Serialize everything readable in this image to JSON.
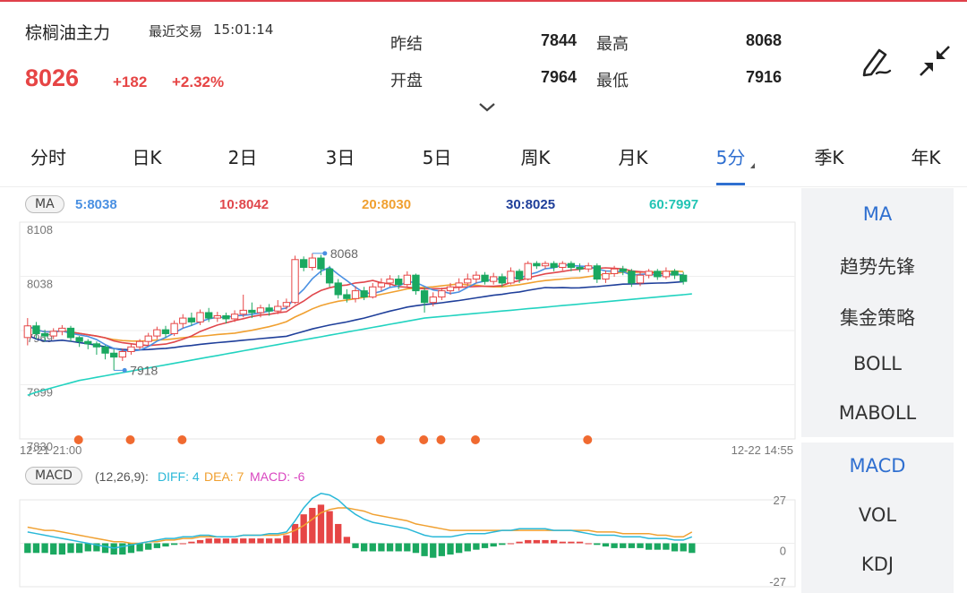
{
  "header": {
    "symbol": "棕榈油主力",
    "last_trade_label": "最近交易",
    "last_trade_time": "15:01:14",
    "price": "8026",
    "change": "+182",
    "change_pct": "+2.32%",
    "quote": {
      "prev_settle_label": "昨结",
      "prev_settle": "7844",
      "high_label": "最高",
      "high": "8068",
      "open_label": "开盘",
      "open": "7964",
      "low_label": "最低",
      "low": "7916"
    }
  },
  "tabs": [
    {
      "label": "分时"
    },
    {
      "label": "日K"
    },
    {
      "label": "2日"
    },
    {
      "label": "3日"
    },
    {
      "label": "5日"
    },
    {
      "label": "周K"
    },
    {
      "label": "月K"
    },
    {
      "label": "5分"
    },
    {
      "label": "季K"
    },
    {
      "label": "年K"
    }
  ],
  "active_tab": "5分",
  "ma_bar": {
    "badge": "MA",
    "ma5": "5:8038",
    "ma10": "10:8042",
    "ma20": "20:8030",
    "ma30": "30:8025",
    "ma60": "60:7997"
  },
  "price_axis": [
    "8108",
    "8038",
    "7969",
    "7899",
    "7830"
  ],
  "annotations": {
    "high": "8068",
    "low": "7918"
  },
  "time_axis": {
    "start": "12-21 21:00",
    "end": "12-22 14:55"
  },
  "macd_bar": {
    "badge": "MACD",
    "params": "(12,26,9):",
    "diff": "DIFF: 4",
    "dea": "DEA: 7",
    "macd": "MACD: -6"
  },
  "macd_axis": [
    "27",
    "0",
    "-27"
  ],
  "side_menu": {
    "group1": [
      "MA",
      "趋势先锋",
      "集金策略",
      "BOLL",
      "MABOLL"
    ],
    "group2": [
      "MACD",
      "VOL",
      "KDJ"
    ]
  },
  "colors": {
    "up": "#e64545",
    "down": "#1aa860",
    "accent": "#2f6fd0",
    "ma5": "#4a90e2",
    "ma10": "#e0474c",
    "ma20": "#f0a030",
    "ma30": "#1f3f9a",
    "ma60": "#22d3c0",
    "diff": "#2ab8d8",
    "dea": "#f0a030",
    "macd": "#d946c0"
  },
  "chart_data": [
    {
      "type": "candlestick",
      "interval": "5分",
      "ylim": [
        7830,
        8108
      ],
      "candles": [
        {
          "o": 7960,
          "c": 7975,
          "h": 7985,
          "l": 7950
        },
        {
          "o": 7975,
          "c": 7965,
          "h": 7980,
          "l": 7958
        },
        {
          "o": 7965,
          "c": 7962,
          "h": 7970,
          "l": 7955
        },
        {
          "o": 7962,
          "c": 7968,
          "h": 7972,
          "l": 7958
        },
        {
          "o": 7968,
          "c": 7972,
          "h": 7976,
          "l": 7963
        },
        {
          "o": 7972,
          "c": 7960,
          "h": 7975,
          "l": 7955
        },
        {
          "o": 7960,
          "c": 7955,
          "h": 7962,
          "l": 7948
        },
        {
          "o": 7955,
          "c": 7952,
          "h": 7958,
          "l": 7945
        },
        {
          "o": 7952,
          "c": 7948,
          "h": 7955,
          "l": 7938
        },
        {
          "o": 7948,
          "c": 7940,
          "h": 7950,
          "l": 7932
        },
        {
          "o": 7940,
          "c": 7935,
          "h": 7945,
          "l": 7918
        },
        {
          "o": 7935,
          "c": 7942,
          "h": 7946,
          "l": 7930
        },
        {
          "o": 7942,
          "c": 7948,
          "h": 7952,
          "l": 7938
        },
        {
          "o": 7948,
          "c": 7955,
          "h": 7958,
          "l": 7944
        },
        {
          "o": 7955,
          "c": 7962,
          "h": 7966,
          "l": 7950
        },
        {
          "o": 7962,
          "c": 7970,
          "h": 7974,
          "l": 7958
        },
        {
          "o": 7970,
          "c": 7965,
          "h": 7975,
          "l": 7960
        },
        {
          "o": 7965,
          "c": 7978,
          "h": 7982,
          "l": 7962
        },
        {
          "o": 7978,
          "c": 7985,
          "h": 7990,
          "l": 7972
        },
        {
          "o": 7985,
          "c": 7980,
          "h": 7992,
          "l": 7975
        },
        {
          "o": 7980,
          "c": 7992,
          "h": 7996,
          "l": 7976
        },
        {
          "o": 7992,
          "c": 7985,
          "h": 7998,
          "l": 7980
        },
        {
          "o": 7985,
          "c": 7988,
          "h": 7993,
          "l": 7980
        },
        {
          "o": 7988,
          "c": 7984,
          "h": 7992,
          "l": 7978
        },
        {
          "o": 7984,
          "c": 7990,
          "h": 7995,
          "l": 7980
        },
        {
          "o": 7990,
          "c": 7995,
          "h": 8015,
          "l": 7986
        },
        {
          "o": 7995,
          "c": 7992,
          "h": 8005,
          "l": 7985
        },
        {
          "o": 7992,
          "c": 7998,
          "h": 8002,
          "l": 7986
        },
        {
          "o": 7998,
          "c": 7994,
          "h": 8003,
          "l": 7988
        },
        {
          "o": 7994,
          "c": 8000,
          "h": 8008,
          "l": 7990
        },
        {
          "o": 8000,
          "c": 8005,
          "h": 8010,
          "l": 7996
        },
        {
          "o": 8005,
          "c": 8060,
          "h": 8065,
          "l": 8003
        },
        {
          "o": 8060,
          "c": 8050,
          "h": 8064,
          "l": 8045
        },
        {
          "o": 8050,
          "c": 8062,
          "h": 8068,
          "l": 8046
        },
        {
          "o": 8062,
          "c": 8048,
          "h": 8066,
          "l": 8040
        },
        {
          "o": 8048,
          "c": 8030,
          "h": 8052,
          "l": 8025
        },
        {
          "o": 8030,
          "c": 8015,
          "h": 8035,
          "l": 8010
        },
        {
          "o": 8015,
          "c": 8010,
          "h": 8022,
          "l": 8005
        },
        {
          "o": 8010,
          "c": 8020,
          "h": 8026,
          "l": 8005
        },
        {
          "o": 8020,
          "c": 8012,
          "h": 8025,
          "l": 8008
        },
        {
          "o": 8012,
          "c": 8025,
          "h": 8030,
          "l": 8010
        },
        {
          "o": 8025,
          "c": 8030,
          "h": 8036,
          "l": 8020
        },
        {
          "o": 8030,
          "c": 8035,
          "h": 8040,
          "l": 8025
        },
        {
          "o": 8035,
          "c": 8028,
          "h": 8040,
          "l": 8022
        },
        {
          "o": 8028,
          "c": 8040,
          "h": 8045,
          "l": 8025
        },
        {
          "o": 8040,
          "c": 8020,
          "h": 8042,
          "l": 8015
        },
        {
          "o": 8020,
          "c": 8005,
          "h": 8024,
          "l": 7992
        },
        {
          "o": 8005,
          "c": 8012,
          "h": 8018,
          "l": 8000
        },
        {
          "o": 8012,
          "c": 8020,
          "h": 8024,
          "l": 8008
        },
        {
          "o": 8020,
          "c": 8025,
          "h": 8030,
          "l": 8015
        },
        {
          "o": 8025,
          "c": 8030,
          "h": 8036,
          "l": 8020
        },
        {
          "o": 8030,
          "c": 8035,
          "h": 8042,
          "l": 8026
        },
        {
          "o": 8035,
          "c": 8040,
          "h": 8045,
          "l": 8030
        },
        {
          "o": 8040,
          "c": 8032,
          "h": 8044,
          "l": 8028
        },
        {
          "o": 8032,
          "c": 8038,
          "h": 8043,
          "l": 8028
        },
        {
          "o": 8038,
          "c": 8030,
          "h": 8042,
          "l": 8025
        },
        {
          "o": 8030,
          "c": 8045,
          "h": 8050,
          "l": 8028
        },
        {
          "o": 8045,
          "c": 8035,
          "h": 8048,
          "l": 8030
        },
        {
          "o": 8035,
          "c": 8055,
          "h": 8058,
          "l": 8033
        },
        {
          "o": 8055,
          "c": 8052,
          "h": 8058,
          "l": 8048
        },
        {
          "o": 8052,
          "c": 8055,
          "h": 8058,
          "l": 8048
        },
        {
          "o": 8055,
          "c": 8050,
          "h": 8058,
          "l": 8045
        },
        {
          "o": 8050,
          "c": 8055,
          "h": 8058,
          "l": 8046
        },
        {
          "o": 8055,
          "c": 8050,
          "h": 8058,
          "l": 8045
        },
        {
          "o": 8050,
          "c": 8048,
          "h": 8055,
          "l": 8044
        },
        {
          "o": 8048,
          "c": 8052,
          "h": 8056,
          "l": 8044
        },
        {
          "o": 8052,
          "c": 8035,
          "h": 8055,
          "l": 8030
        },
        {
          "o": 8035,
          "c": 8042,
          "h": 8046,
          "l": 8030
        },
        {
          "o": 8042,
          "c": 8048,
          "h": 8052,
          "l": 8038
        },
        {
          "o": 8048,
          "c": 8045,
          "h": 8052,
          "l": 8040
        },
        {
          "o": 8045,
          "c": 8030,
          "h": 8048,
          "l": 8025
        },
        {
          "o": 8030,
          "c": 8040,
          "h": 8044,
          "l": 8026
        },
        {
          "o": 8040,
          "c": 8045,
          "h": 8048,
          "l": 8036
        },
        {
          "o": 8045,
          "c": 8038,
          "h": 8048,
          "l": 8034
        },
        {
          "o": 8038,
          "c": 8045,
          "h": 8050,
          "l": 8035
        },
        {
          "o": 8045,
          "c": 8040,
          "h": 8048,
          "l": 8035
        },
        {
          "o": 8040,
          "c": 8032,
          "h": 8044,
          "l": 8028
        }
      ],
      "ma60_series": [
        7886,
        7890,
        7893,
        7896,
        7899,
        7902,
        7905,
        7907,
        7909,
        7911,
        7913,
        7915,
        7917,
        7919,
        7921,
        7923,
        7925,
        7927,
        7929,
        7931,
        7933,
        7935,
        7937,
        7939,
        7941,
        7943,
        7945,
        7947,
        7949,
        7951,
        7953,
        7955,
        7957,
        7959,
        7961,
        7963,
        7965,
        7967,
        7969,
        7971,
        7973,
        7975,
        7977,
        7979,
        7981,
        7983,
        7985,
        7986,
        7987,
        7988,
        7989,
        7990,
        7991,
        7992,
        7993,
        7994,
        7995,
        7996,
        7997,
        7998,
        7999,
        8000,
        8001,
        8002,
        8003,
        8004,
        8005,
        8006,
        8007,
        8008,
        8009,
        8010,
        8011,
        8012,
        8013,
        8014,
        8015,
        8016
      ],
      "signal_markers": 8
    },
    {
      "type": "macd",
      "ylim": [
        -27,
        27
      ],
      "diff": [
        7,
        6,
        5,
        4,
        3,
        2,
        1,
        0,
        -1,
        -2,
        -3,
        -2,
        -1,
        0,
        1,
        2,
        3,
        3,
        4,
        4,
        5,
        5,
        4,
        4,
        4,
        5,
        5,
        5,
        6,
        6,
        7,
        14,
        22,
        28,
        31,
        30,
        27,
        22,
        18,
        15,
        13,
        12,
        11,
        10,
        9,
        7,
        5,
        4,
        4,
        4,
        5,
        6,
        6,
        6,
        7,
        8,
        8,
        9,
        9,
        9,
        9,
        8,
        8,
        8,
        7,
        6,
        5,
        5,
        5,
        4,
        4,
        4,
        3,
        3,
        3,
        2,
        2,
        4
      ],
      "dea": [
        10,
        9,
        8,
        8,
        7,
        6,
        5,
        4,
        3,
        2,
        1,
        1,
        0,
        0,
        1,
        1,
        2,
        2,
        3,
        3,
        4,
        4,
        4,
        4,
        4,
        5,
        5,
        5,
        5,
        5,
        6,
        8,
        11,
        15,
        19,
        21,
        22,
        22,
        21,
        20,
        18,
        17,
        16,
        15,
        14,
        12,
        11,
        10,
        9,
        8,
        8,
        8,
        8,
        8,
        8,
        8,
        8,
        8,
        8,
        8,
        8,
        8,
        8,
        8,
        8,
        8,
        7,
        7,
        7,
        6,
        6,
        6,
        6,
        5,
        5,
        4,
        4,
        7
      ],
      "hist": [
        -6,
        -6,
        -6,
        -7,
        -7,
        -6,
        -6,
        -5,
        -5,
        -6,
        -7,
        -7,
        -6,
        -5,
        -4,
        -3,
        -2,
        -1,
        0,
        1,
        2,
        3,
        3,
        3,
        3,
        3,
        3,
        3,
        3,
        3,
        5,
        12,
        18,
        22,
        24,
        20,
        12,
        4,
        -3,
        -5,
        -5,
        -5,
        -5,
        -5,
        -5,
        -6,
        -8,
        -9,
        -8,
        -7,
        -6,
        -5,
        -4,
        -3,
        -2,
        -1,
        0,
        1,
        2,
        2,
        2,
        2,
        1,
        1,
        1,
        0,
        -1,
        -2,
        -3,
        -3,
        -3,
        -3,
        -4,
        -4,
        -4,
        -5,
        -5,
        -6
      ]
    }
  ]
}
